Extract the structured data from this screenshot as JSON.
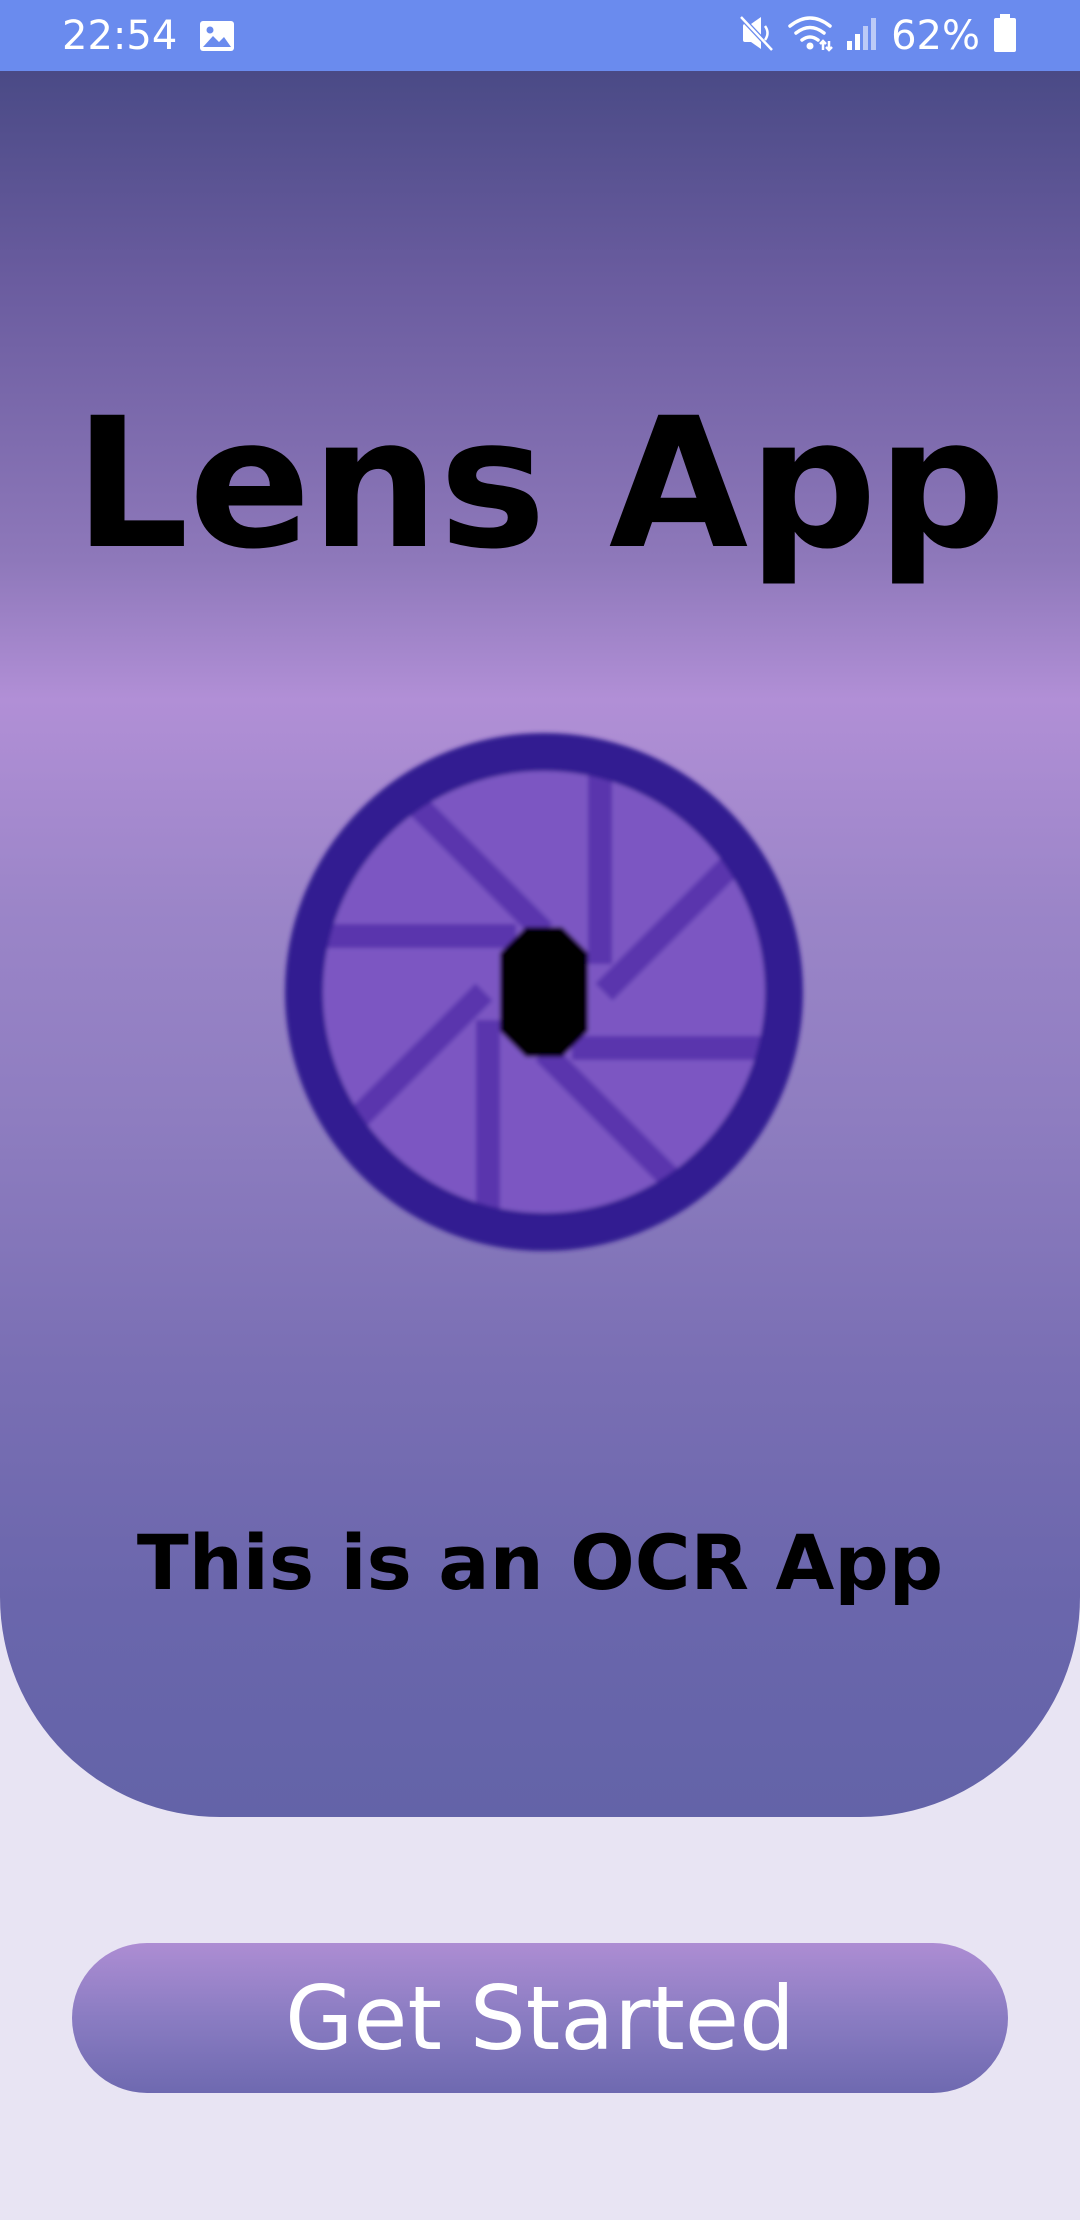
{
  "status_bar": {
    "time": "22:54",
    "battery": "62%",
    "icons": [
      "gallery-icon",
      "mute-icon",
      "wifi-icon",
      "signal-icon",
      "battery-icon"
    ]
  },
  "hero": {
    "title": "Lens App",
    "subtitle": "This is an OCR App",
    "logo_icon": "camera-aperture-icon"
  },
  "actions": {
    "get_started_label": "Get Started"
  },
  "colors": {
    "status_bar": "#6a8bee",
    "page_background": "#e8e4f3",
    "hero_top": "#4a4a86",
    "hero_mid": "#b18fd6",
    "hero_bottom": "#6363a8",
    "aperture_ring": "#301e91",
    "aperture_blades": "#7c57c2",
    "button_top": "#ad8dd3",
    "button_bottom": "#6e69b0"
  }
}
